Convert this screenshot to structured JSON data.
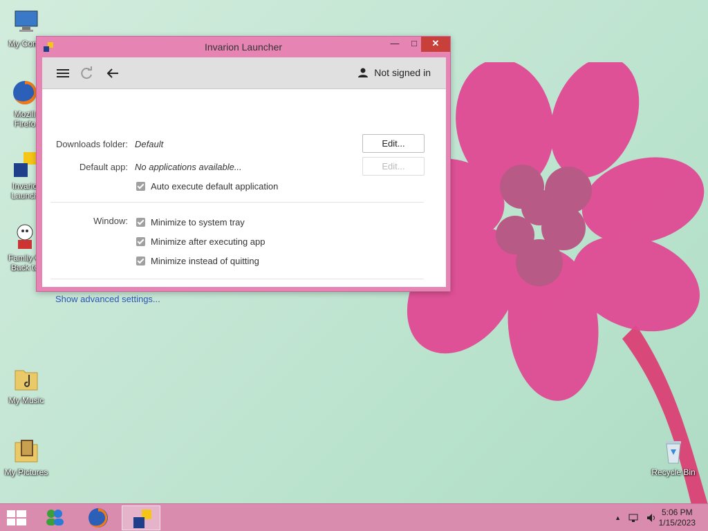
{
  "desktop": {
    "icons": [
      {
        "label": "My Comp",
        "icon": "computer-icon"
      },
      {
        "label": "Mozill\nFirefo",
        "icon": "firefox-icon"
      },
      {
        "label": "Invario\nLaunch",
        "icon": "launcher-icon"
      },
      {
        "label": "Family G\nBack to",
        "icon": "game-icon"
      },
      {
        "label": "My Music",
        "icon": "music-folder-icon"
      },
      {
        "label": "My Pictures",
        "icon": "pictures-folder-icon"
      },
      {
        "label": "Recycle Bin",
        "icon": "recycle-bin-icon"
      }
    ]
  },
  "window": {
    "title": "Invarion Launcher",
    "controls": {
      "minimize": "—",
      "maximize": "□",
      "close": "✕"
    },
    "toolbar": {
      "menu_icon": "hamburger-menu-icon",
      "refresh_icon": "refresh-icon",
      "back_icon": "back-arrow-icon",
      "signin_label": "Not signed in"
    },
    "settings": {
      "downloads_label": "Downloads folder:",
      "downloads_value": "Default",
      "downloads_button": "Edit...",
      "default_app_label": "Default app:",
      "default_app_value": "No applications available...",
      "default_app_button": "Edit...",
      "auto_execute": "Auto execute default application",
      "window_label": "Window:",
      "window_options": [
        "Minimize to system tray",
        "Minimize after executing app",
        "Minimize instead of quitting"
      ],
      "advanced_link": "Show advanced settings..."
    }
  },
  "taskbar": {
    "clock_time": "5:06 PM",
    "clock_date": "1/15/2023",
    "tray_up": "▲"
  },
  "colors": {
    "window_frame": "#e684b3",
    "close_button": "#c7403a",
    "taskbar": "#d98cae",
    "link": "#2a54b5"
  }
}
